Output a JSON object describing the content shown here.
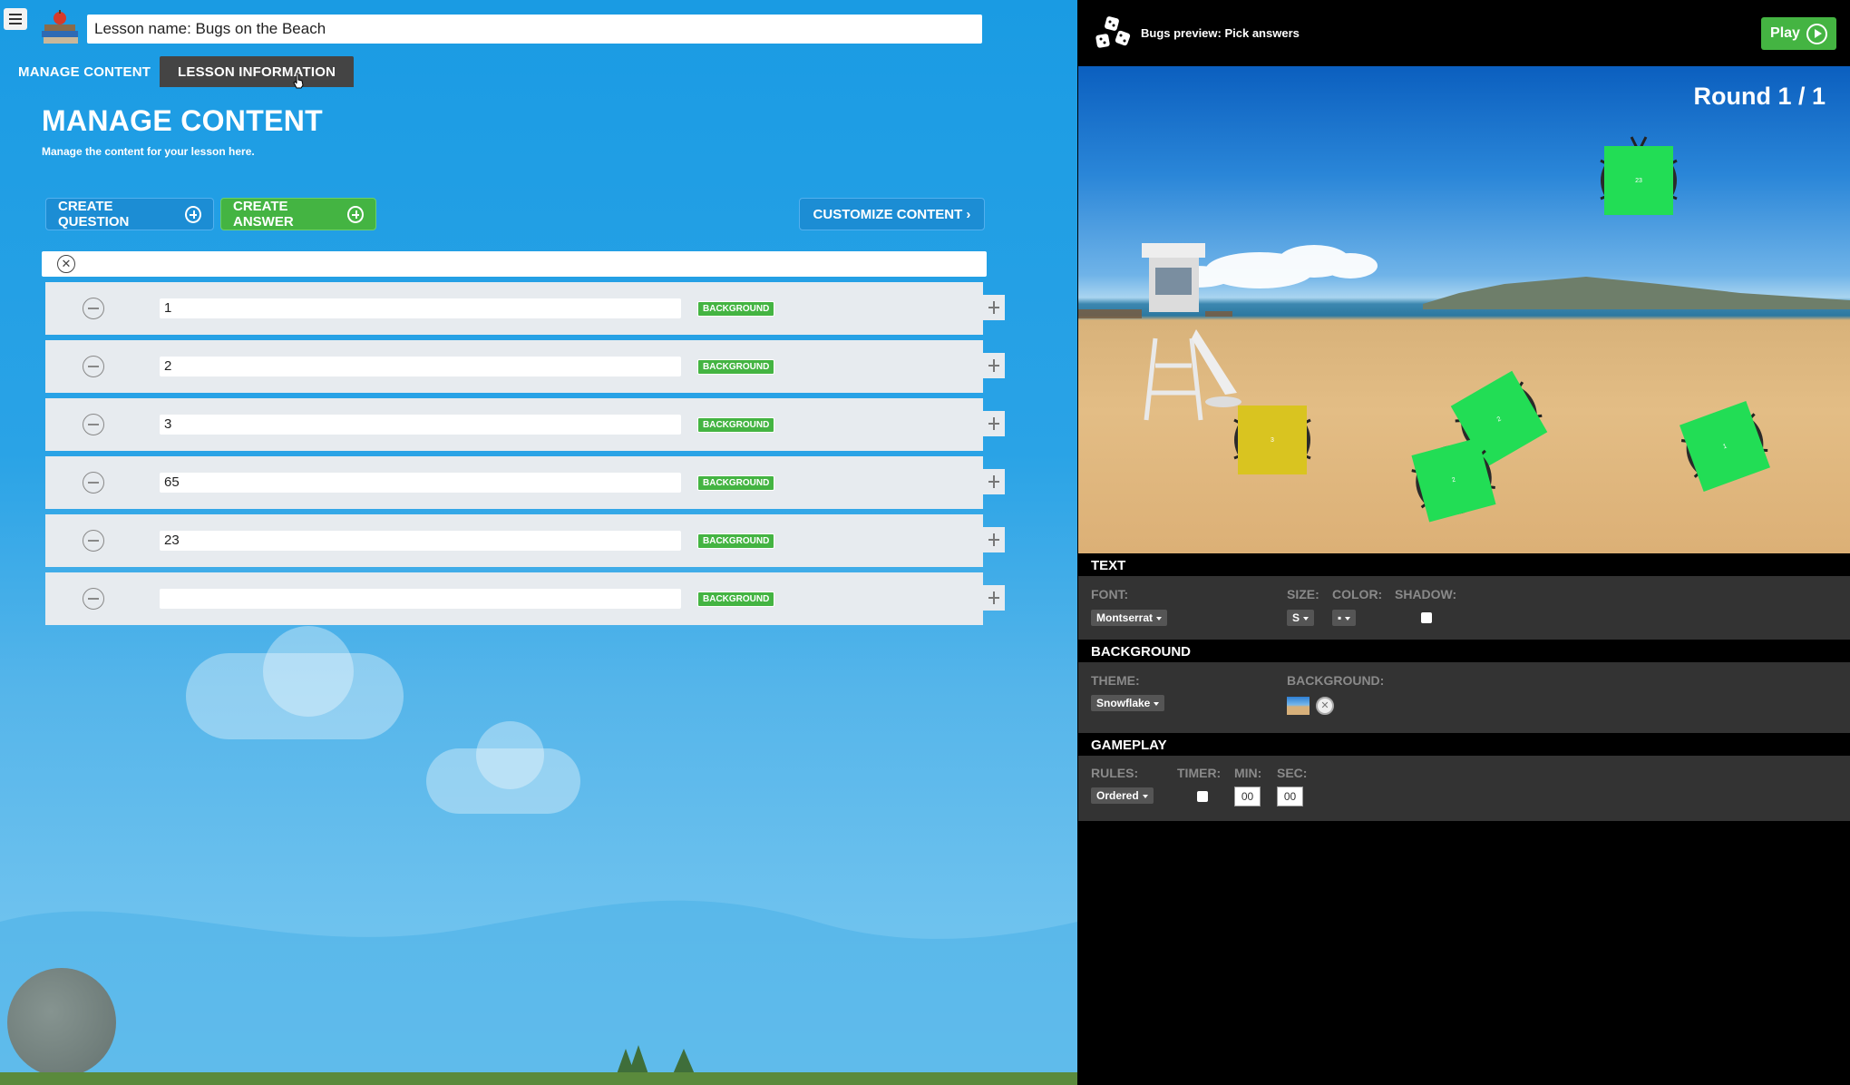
{
  "header": {
    "lesson_name": "Lesson name:  Bugs on the Beach"
  },
  "tabs": [
    {
      "label": "MANAGE CONTENT"
    },
    {
      "label": "LESSON INFORMATION"
    }
  ],
  "main": {
    "title": "MANAGE CONTENT",
    "subtitle": "Manage the content for your lesson here.",
    "create_question": "CREATE QUESTION",
    "create_answer": "CREATE ANSWER",
    "customize_content": "CUSTOMIZE CONTENT ›",
    "answers": [
      {
        "value": "1",
        "badge": "BACKGROUND"
      },
      {
        "value": "2",
        "badge": "BACKGROUND"
      },
      {
        "value": "3",
        "badge": "BACKGROUND"
      },
      {
        "value": "65",
        "badge": "BACKGROUND"
      },
      {
        "value": "23",
        "badge": "BACKGROUND"
      },
      {
        "value": "",
        "badge": "BACKGROUND"
      }
    ]
  },
  "preview": {
    "title": "Bugs preview: Pick answers",
    "play_label": "Play",
    "round": "Round 1 / 1",
    "bugs": [
      {
        "label": "23",
        "color": "#22dd55"
      },
      {
        "label": "3",
        "color": "#d9c420"
      },
      {
        "label": "2",
        "color": "#22dd55"
      },
      {
        "label": "2",
        "color": "#22dd55"
      },
      {
        "label": "1",
        "color": "#22dd55"
      }
    ]
  },
  "settings": {
    "text": {
      "header": "TEXT",
      "font_label": "FONT:",
      "font_value": "Montserrat",
      "size_label": "SIZE:",
      "size_value": "S",
      "color_label": "COLOR:",
      "color_value": "▪",
      "shadow_label": "SHADOW:"
    },
    "background": {
      "header": "BACKGROUND",
      "theme_label": "THEME:",
      "theme_value": "Snowflake",
      "background_label": "BACKGROUND:"
    },
    "gameplay": {
      "header": "GAMEPLAY",
      "rules_label": "RULES:",
      "rules_value": "Ordered",
      "timer_label": "TIMER:",
      "min_label": "MIN:",
      "min_value": "00",
      "sec_label": "SEC:",
      "sec_value": "00"
    }
  },
  "colors": {
    "accent_green": "#44b442",
    "accent_blue": "#1c8dd4",
    "panel_dark": "#333333"
  }
}
